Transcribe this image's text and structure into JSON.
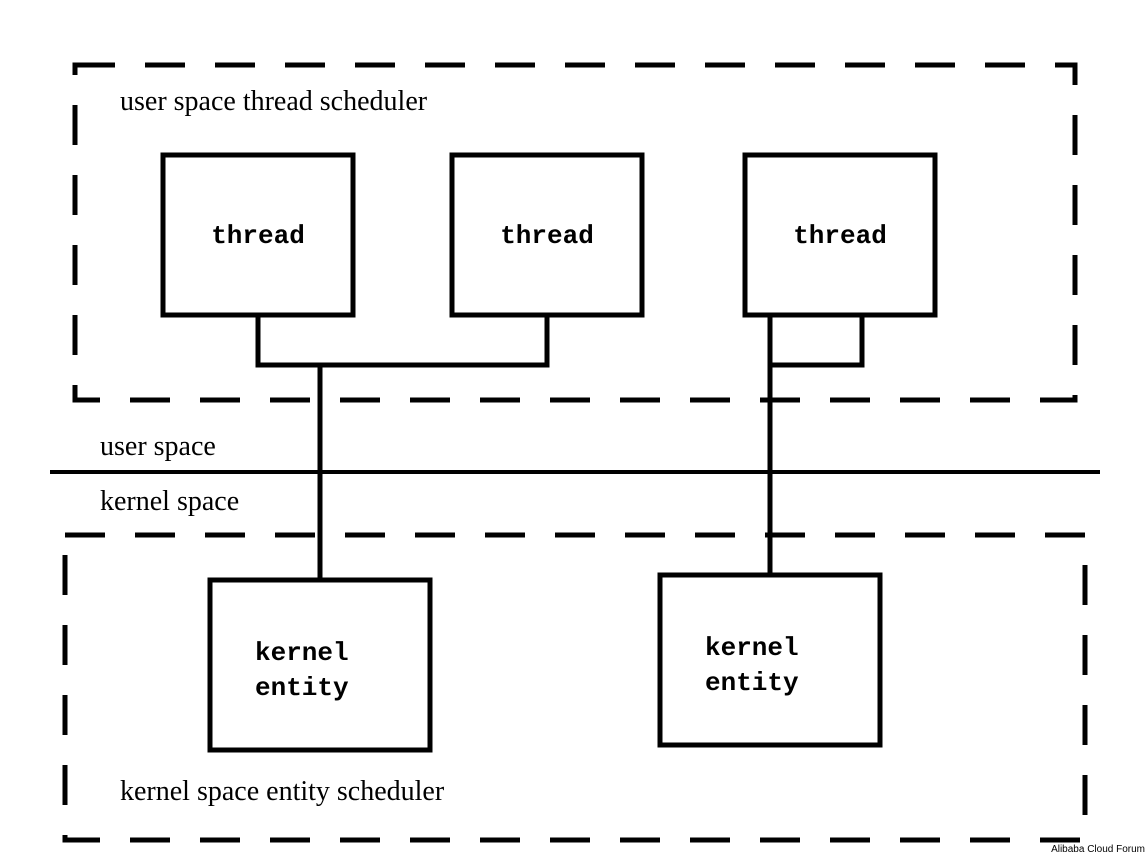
{
  "user_scheduler_title": "user space thread scheduler",
  "kernel_scheduler_title": "kernel space entity scheduler",
  "threads": [
    "thread",
    "thread",
    "thread"
  ],
  "kernel_entities": [
    {
      "l1": "kernel",
      "l2": "entity"
    },
    {
      "l1": "kernel",
      "l2": "entity"
    }
  ],
  "user_space_label": "user space",
  "kernel_space_label": "kernel space",
  "watermark": "Alibaba Cloud Forum"
}
